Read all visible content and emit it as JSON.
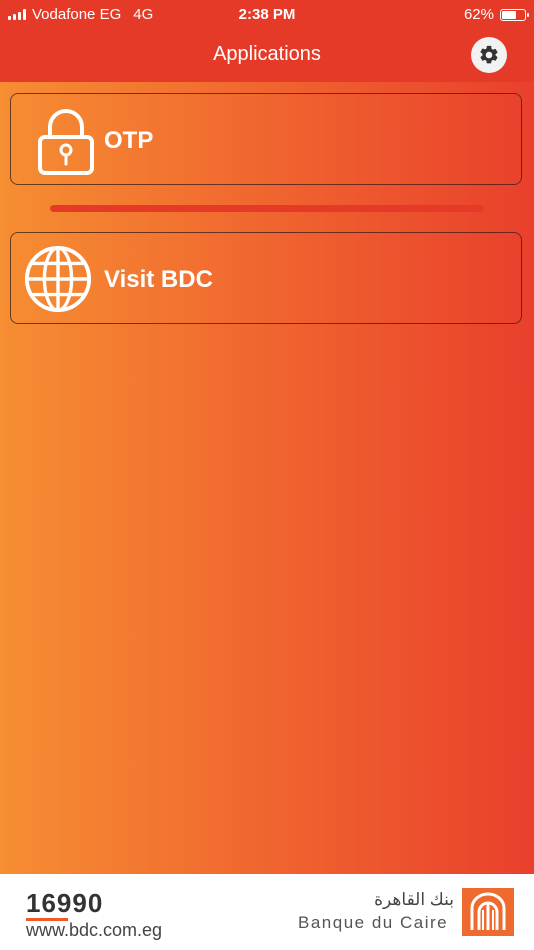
{
  "status_bar": {
    "carrier": "Vodafone EG",
    "network": "4G",
    "time": "2:38 PM",
    "battery_percent": "62%",
    "battery_level": 0.62
  },
  "nav": {
    "title": "Applications",
    "settings_icon": "gear-icon"
  },
  "apps": [
    {
      "label": "OTP",
      "icon": "lock-icon"
    },
    {
      "label": "Visit BDC",
      "icon": "globe-icon"
    }
  ],
  "footer": {
    "hotline": "16990",
    "website": "www.bdc.com.eg",
    "bank_name_arabic": "بنك القاهرة",
    "bank_name": "Banque du Caire",
    "logo_icon": "bdc-logo-icon"
  },
  "colors": {
    "brand_red": "#e63a29",
    "gradient_start": "#f68e32",
    "gradient_end": "#e9402c"
  }
}
